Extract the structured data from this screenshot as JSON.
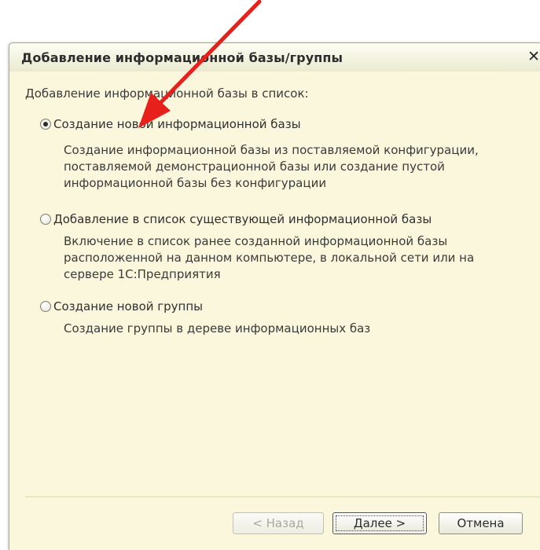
{
  "dialog": {
    "title": "Добавление информационной базы/группы",
    "close_label": "✕"
  },
  "content": {
    "group_label": "Добавление информационной базы в список:",
    "options": [
      {
        "label": "Создание новой информационной базы",
        "checked": true,
        "description": [
          "Создание информационной базы из поставляемой конфигурации,",
          "поставляемой демонстрационной базы или создание пустой",
          "информационной базы без конфигурации"
        ]
      },
      {
        "label": "Добавление в список существующей информационной базы",
        "checked": false,
        "description": [
          "Включение в список ранее созданной информационной базы",
          "расположенной на данном компьютере,  в локальной сети или на",
          "сервере 1С:Предприятия"
        ]
      },
      {
        "label": "Создание новой группы",
        "checked": false,
        "description": [
          "Создание группы в дереве информационных баз"
        ]
      }
    ]
  },
  "buttons": {
    "back": "< Назад",
    "next": "Далее >",
    "cancel": "Отмена"
  },
  "colors": {
    "dialog_bg": "#fbf7dc",
    "annotation_arrow": "#e8201c"
  }
}
